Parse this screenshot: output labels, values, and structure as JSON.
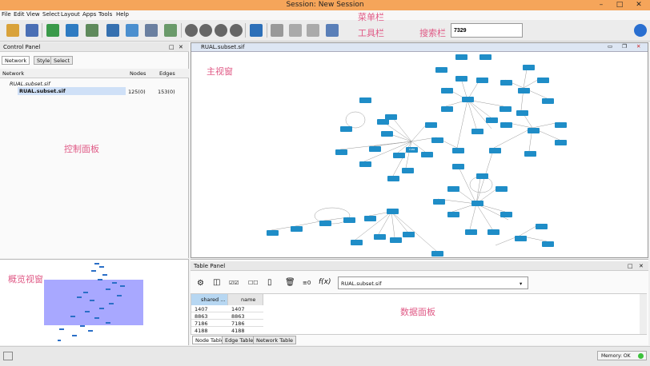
{
  "window": {
    "title": "Session: New Session",
    "buttons": {
      "minimize": "–",
      "maximize": "□",
      "close": "✕"
    }
  },
  "menu": [
    "File",
    "Edit",
    "View",
    "Select",
    "Layout",
    "Apps",
    "Tools",
    "Help"
  ],
  "search": {
    "value": "7329"
  },
  "annotations": {
    "menubar": "菜单栏",
    "toolbar": "工具栏",
    "searchbar": "搜索栏",
    "mainview": "主视窗",
    "controlpanel": "控制面板",
    "overview": "概览视窗",
    "datapanel": "数据面板"
  },
  "control_panel": {
    "title": "Control Panel",
    "tabs": [
      "Network",
      "Style",
      "Select"
    ],
    "columns": [
      "Network",
      "Nodes",
      "Edges"
    ],
    "collection": "RUAL.subset.sif",
    "network": {
      "name": "RUAL.subset.sif",
      "nodes": "125(0)",
      "edges": "153(0)"
    }
  },
  "network_view": {
    "title": "RUAL.subset.sif"
  },
  "table_panel": {
    "title": "Table Panel",
    "selected_network": "RUAL.subset.sif",
    "columns": [
      "shared ...",
      "name"
    ],
    "rows": [
      [
        "1407",
        "1407"
      ],
      [
        "8863",
        "8863"
      ],
      [
        "7186",
        "7186"
      ],
      [
        "4188",
        "4188"
      ]
    ],
    "tabs": [
      "Node Table",
      "Edge Table",
      "Network Table"
    ]
  },
  "status": {
    "memory": "Memory: OK"
  },
  "colors": {
    "titlebar": "#f5a55a",
    "node": "#1f8dc7",
    "overview_view": "#a8a8ff",
    "annotation": "#e05a86",
    "memory_ok": "#3cc13c"
  }
}
